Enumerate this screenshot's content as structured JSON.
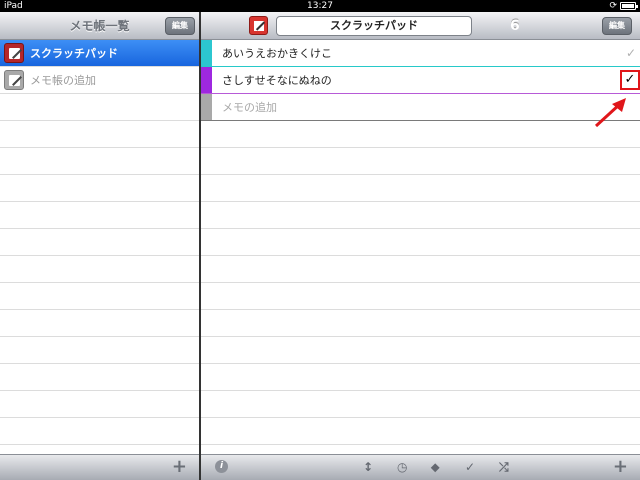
{
  "status": {
    "carrier": "iPad",
    "time": "13:27"
  },
  "sidebar": {
    "title": "メモ帳一覧",
    "edit_label": "編集",
    "items": [
      {
        "label": "スクラッチパッド",
        "selected": true,
        "icon": "notepad-icon",
        "color": "#b4262a"
      },
      {
        "label": "メモ帳の追加",
        "selected": false,
        "icon": "add-notepad-icon",
        "color": "#a9a9a9"
      }
    ],
    "add_label": "+"
  },
  "main": {
    "title": "スクラッチパッド",
    "count": "6",
    "edit_label": "編集",
    "memos": [
      {
        "text": "あいうえおかきくけこ",
        "color": "#2cc7d0",
        "checked": false
      },
      {
        "text": "さしすせそなにぬねの",
        "color": "#9e28e0",
        "checked": true
      },
      {
        "text": "メモの追加",
        "color": "#a9a9a9",
        "checked": false
      }
    ],
    "toolbar": {
      "info": "i",
      "sort": "↕",
      "clock": "◷",
      "tag": "⬥",
      "check": "✓",
      "shuffle": "⤮",
      "add": "+"
    }
  }
}
